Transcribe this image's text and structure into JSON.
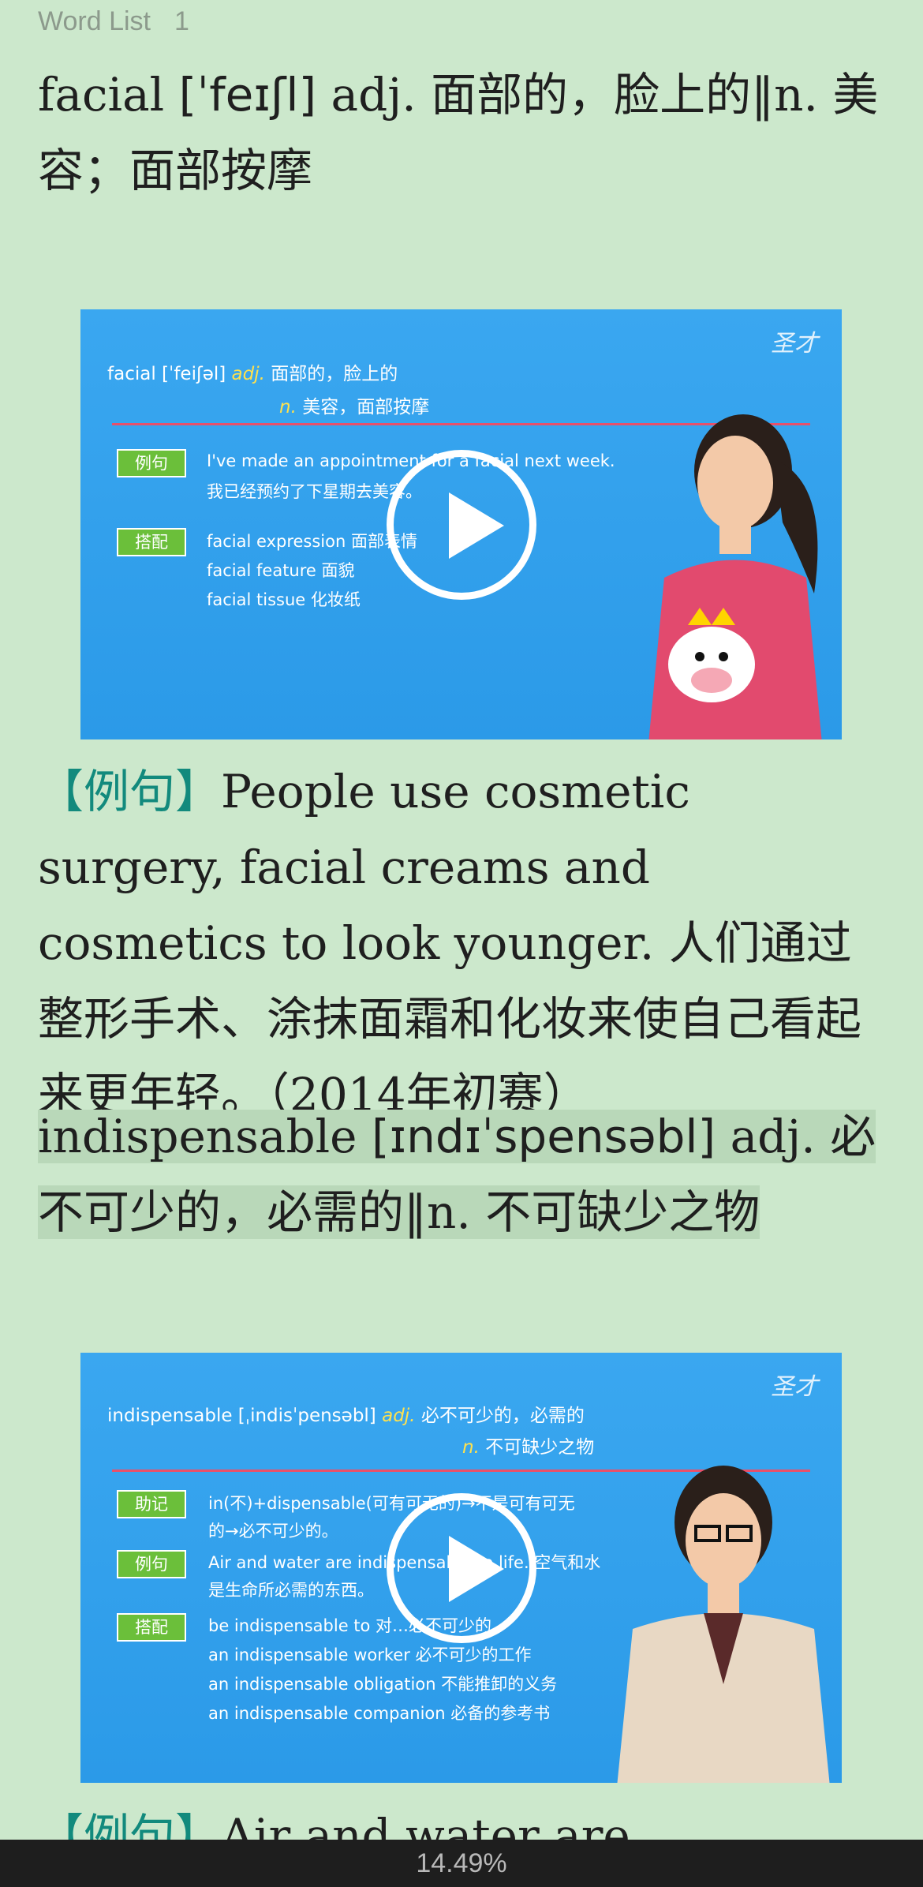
{
  "header": {
    "title": "Word List",
    "count": "1"
  },
  "entries": [
    {
      "word": "facial",
      "ipa": "[ˈfeɪʃl]",
      "definition": "adj. 面部的，脸上的‖n. 美容；面部按摩",
      "video": {
        "logo": "圣才",
        "title_word": "facial",
        "title_ipa": "[ˈfeiʃəl]",
        "title_pos": "adj.",
        "title_def": "面部的，脸上的",
        "sub_pos": "n.",
        "sub_def": "美容，面部按摩",
        "labels": [
          "例句",
          "搭配"
        ],
        "lines": [
          "I've made an appointment for a facial next week.",
          "我已经预约了下星期去美容。",
          "facial expression 面部表情",
          "facial feature 面貌",
          "facial tissue 化妆纸"
        ]
      },
      "example_tag": "【例句】",
      "example_text": "People use cosmetic surgery, facial creams and cosmetics to look younger. 人们通过整形手术、涂抹面霜和化妆来使自己看起来更年轻。（2014年初赛）"
    },
    {
      "word": "indispensable",
      "ipa": "[ɪndɪˈspensəbl]",
      "definition": "adj. 必不可少的，必需的‖n. 不可缺少之物",
      "video": {
        "logo": "圣才",
        "title_word": "indispensable",
        "title_ipa": "[ˌindisˈpensəbl]",
        "title_pos": "adj.",
        "title_def": "必不可少的，必需的",
        "sub_pos": "n.",
        "sub_def": "不可缺少之物",
        "labels": [
          "助记",
          "例句",
          "搭配"
        ],
        "lines": [
          "in(不)+dispensable(可有可无的)→不是可有可无",
          "的→必不可少的。",
          "Air and water are indispensable to life. 空气和水",
          "是生命所必需的东西。",
          "be indispensable to 对…必不可少的",
          "an indispensable worker 必不可少的工作",
          "an indispensable obligation 不能推卸的义务",
          "an indispensable companion 必备的参考书"
        ]
      },
      "example_tag": "【例句】",
      "example_text": "Air and water are indispensable to"
    }
  ],
  "footer": {
    "progress_text": "14.49%",
    "progress": 14.49
  }
}
